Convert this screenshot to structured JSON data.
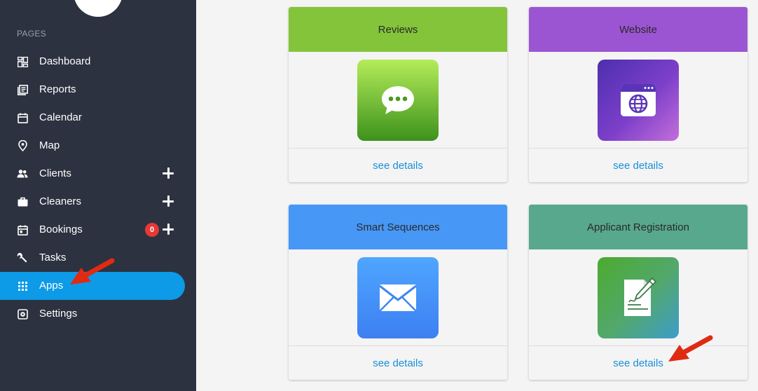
{
  "sidebar": {
    "section_label": "PAGES",
    "items": [
      {
        "label": "Dashboard",
        "icon": "dashboard-icon"
      },
      {
        "label": "Reports",
        "icon": "reports-icon"
      },
      {
        "label": "Calendar",
        "icon": "calendar-icon"
      },
      {
        "label": "Map",
        "icon": "map-pin-icon"
      },
      {
        "label": "Clients",
        "icon": "clients-icon",
        "has_add": true
      },
      {
        "label": "Cleaners",
        "icon": "briefcase-icon",
        "has_add": true
      },
      {
        "label": "Bookings",
        "icon": "bookings-icon",
        "has_add": true,
        "badge": "0"
      },
      {
        "label": "Tasks",
        "icon": "wrench-icon"
      },
      {
        "label": "Apps",
        "icon": "apps-grid-icon",
        "active": true
      },
      {
        "label": "Settings",
        "icon": "settings-icon"
      }
    ]
  },
  "apps": [
    {
      "title": "Reviews",
      "header_color": "#84c43b",
      "link": "see details",
      "icon": "chat-bubble-icon"
    },
    {
      "title": "Website",
      "header_color": "#9c55d2",
      "link": "see details",
      "icon": "browser-globe-icon"
    },
    {
      "title": "Smart Sequences",
      "header_color": "#4797f6",
      "link": "see details",
      "icon": "envelope-icon"
    },
    {
      "title": "Applicant Registration",
      "header_color": "#58a88d",
      "link": "see details",
      "icon": "document-pen-icon"
    }
  ],
  "colors": {
    "sidebar_bg": "#2c3240",
    "active_item": "#0d9ae6",
    "link": "#1a8fd8",
    "badge": "#e53935",
    "annotation_arrow": "#e02a12"
  }
}
